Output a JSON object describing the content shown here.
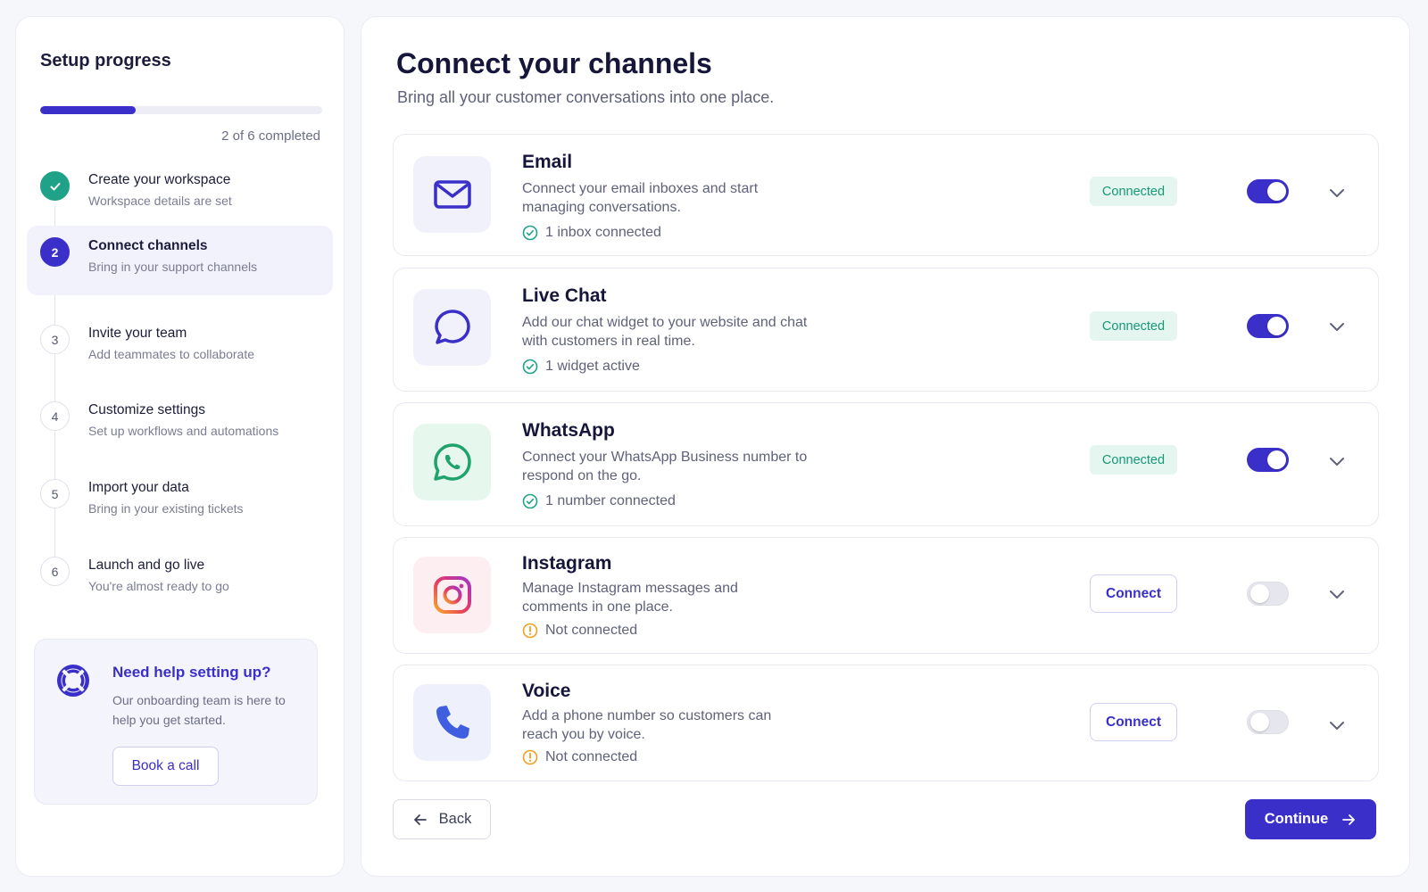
{
  "sidebar": {
    "title": "Setup progress",
    "progress": {
      "completed": 2,
      "total": 6,
      "fraction": 0.34,
      "text": "2 of 6 completed"
    },
    "steps": [
      {
        "number": "",
        "title": "Create your workspace",
        "subtitle": "Workspace details are set",
        "state": "done"
      },
      {
        "number": "2",
        "title": "Connect channels",
        "subtitle": "Bring in your support channels",
        "state": "current"
      },
      {
        "number": "3",
        "title": "Invite your team",
        "subtitle": "Add teammates to collaborate",
        "state": "pending"
      },
      {
        "number": "4",
        "title": "Customize settings",
        "subtitle": "Set up workflows and automations",
        "state": "pending"
      },
      {
        "number": "5",
        "title": "Import your data",
        "subtitle": "Bring in your existing tickets",
        "state": "pending"
      },
      {
        "number": "6",
        "title": "Launch and go live",
        "subtitle": "You're almost ready to go",
        "state": "pending"
      }
    ],
    "help": {
      "title": "Need help setting up?",
      "text": "Our onboarding team is here to help you get started.",
      "button": "Book a call"
    }
  },
  "main": {
    "title": "Connect your channels",
    "subtitle": "Bring all your customer conversations into one place.",
    "channels": [
      {
        "name": "Email",
        "description": "Connect your email inboxes and start managing conversations.",
        "status": "1 inbox connected",
        "connected": true,
        "badge": "Connected",
        "icon": "mail-icon"
      },
      {
        "name": "Live Chat",
        "description": "Add our chat widget to your website and chat with customers in real time.",
        "status": "1 widget active",
        "connected": true,
        "badge": "Connected",
        "icon": "chat-bubble-icon"
      },
      {
        "name": "WhatsApp",
        "description": "Connect your WhatsApp Business number to respond on the go.",
        "status": "1 number connected",
        "connected": true,
        "badge": "Connected",
        "icon": "whatsapp-icon"
      },
      {
        "name": "Instagram",
        "description": "Manage Instagram messages and comments in one place.",
        "status": "Not connected",
        "connected": false,
        "button": "Connect",
        "icon": "instagram-icon"
      },
      {
        "name": "Voice",
        "description": "Add a phone number so customers can reach you by voice.",
        "status": "Not connected",
        "connected": false,
        "button": "Connect",
        "icon": "phone-icon"
      }
    ],
    "back_label": "Back",
    "continue_label": "Continue"
  },
  "colors": {
    "accent": "#3b2fc9",
    "success": "#1fa287",
    "success_badge_bg": "#e4f6ef",
    "warning": "#f0a020"
  }
}
